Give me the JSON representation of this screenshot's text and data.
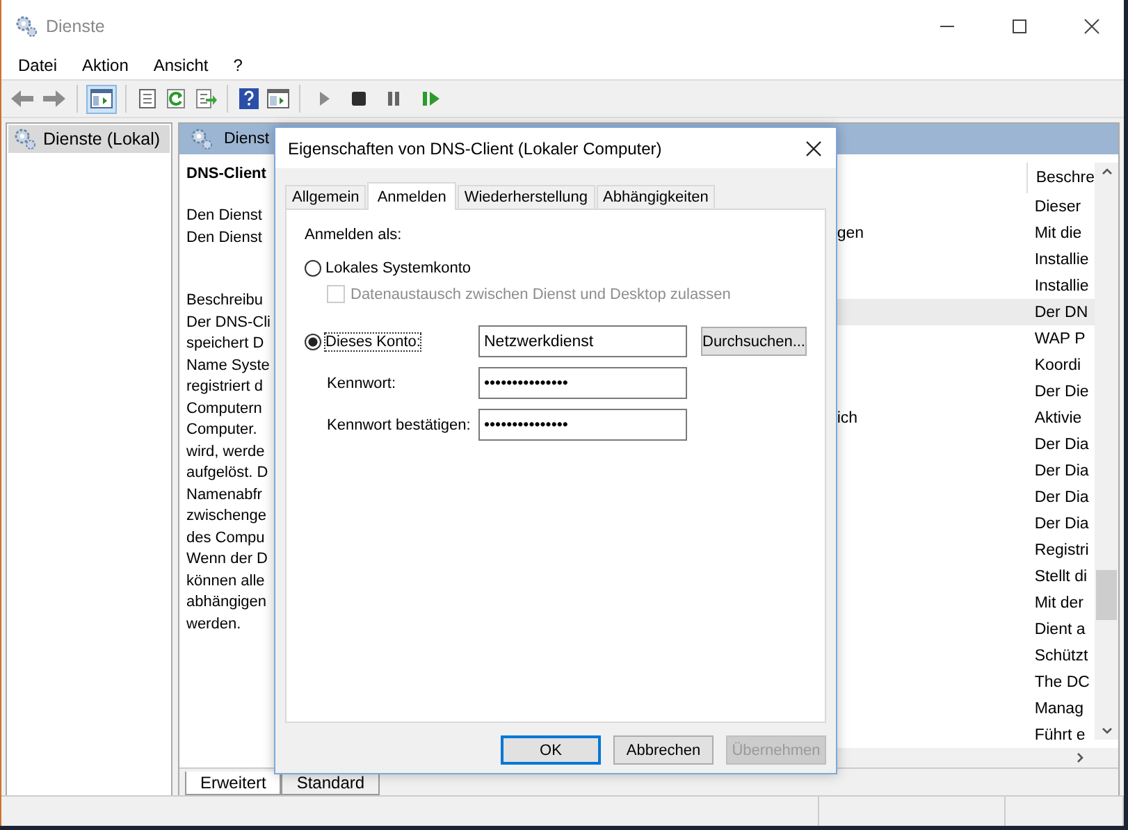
{
  "window": {
    "title": "Dienste"
  },
  "menu": [
    "Datei",
    "Aktion",
    "Ansicht",
    "?"
  ],
  "toolbar": [
    {
      "kind": "back"
    },
    {
      "kind": "forward"
    },
    {
      "kind": "sep"
    },
    {
      "kind": "tree",
      "selected": true
    },
    {
      "kind": "sep"
    },
    {
      "kind": "properties"
    },
    {
      "kind": "refresh"
    },
    {
      "kind": "export"
    },
    {
      "kind": "sep"
    },
    {
      "kind": "help"
    },
    {
      "kind": "console"
    },
    {
      "kind": "sep"
    },
    {
      "kind": "play"
    },
    {
      "kind": "stop"
    },
    {
      "kind": "pause"
    },
    {
      "kind": "resume"
    }
  ],
  "tree": {
    "items": [
      {
        "label": "Dienste (Lokal)",
        "selected": true
      }
    ]
  },
  "pane": {
    "header": "Dienst",
    "service_name": "DNS-Client",
    "actions": [
      "Den Dienst",
      "Den Dienst"
    ],
    "description_lines": [
      "Beschreibu",
      "Der DNS-Cli",
      "speichert D",
      "Name Syste",
      "registriert d",
      "Computern",
      "Computer.",
      "wird, werde",
      "aufgelöst. D",
      "Namenabfr",
      "zwischenge",
      "des Compu",
      "Wenn der D",
      "können alle",
      "abhängigen",
      "werden."
    ],
    "table": {
      "columns": [
        "Beschre"
      ],
      "rows": [
        {
          "column_2": "Dieser",
          "selected": false
        },
        {
          "column_1": "gen",
          "column_2": "Mit die",
          "selected": false
        },
        {
          "column_2": "Installie",
          "selected": false
        },
        {
          "column_2": "Installie",
          "selected": false
        },
        {
          "column_2": "Der DN",
          "selected": true
        },
        {
          "column_2": "WAP P",
          "selected": false
        },
        {
          "column_2": "Koordi",
          "selected": false
        },
        {
          "column_2": "Der Die",
          "selected": false
        },
        {
          "column_1": "ich",
          "column_2": "Aktivie",
          "selected": false
        },
        {
          "column_2": "Der Dia",
          "selected": false
        },
        {
          "column_2": "Der Dia",
          "selected": false
        },
        {
          "column_2": "Der Dia",
          "selected": false
        },
        {
          "column_2": "Der Dia",
          "selected": false
        },
        {
          "column_2": "Registri",
          "selected": false
        },
        {
          "column_2": "Stellt di",
          "selected": false
        },
        {
          "column_2": "Mit der",
          "selected": false
        },
        {
          "column_2": "Dient a",
          "selected": false
        },
        {
          "column_2": "Schützt",
          "selected": false
        },
        {
          "column_2": "The DC",
          "selected": false
        },
        {
          "column_2": "Manag",
          "selected": false
        },
        {
          "column_2": "Führt e",
          "selected": false
        }
      ]
    },
    "view_tabs": [
      {
        "label": "Erweitert",
        "selected": true
      },
      {
        "label": "Standard",
        "selected": false
      }
    ]
  },
  "dialog": {
    "title": "Eigenschaften von DNS-Client (Lokaler Computer)",
    "tabs": [
      {
        "label": "Allgemein",
        "selected": false
      },
      {
        "label": "Anmelden",
        "selected": true
      },
      {
        "label": "Wiederherstellung",
        "selected": false
      },
      {
        "label": "Abhängigkeiten",
        "selected": false
      }
    ],
    "logon_label": "Anmelden als:",
    "local_account": {
      "label": "Lokales Systemkonto",
      "selected": false
    },
    "desktop_interaction": {
      "label": "Datenaustausch zwischen Dienst und Desktop zulassen",
      "checked": false,
      "disabled": true
    },
    "this_account": {
      "label": "Dieses Konto:",
      "selected": true,
      "value": "Netzwerkdienst",
      "browse": "Durchsuchen..."
    },
    "password": {
      "label": "Kennwort:",
      "value": "•••••••••••••••"
    },
    "confirm_password": {
      "label": "Kennwort bestätigen:",
      "value": "•••••••••••••••"
    },
    "buttons": [
      {
        "label": "OK",
        "default": true,
        "disabled": false
      },
      {
        "label": "Abbrechen",
        "default": false,
        "disabled": false
      },
      {
        "label": "Übernehmen",
        "default": false,
        "disabled": true
      }
    ]
  }
}
